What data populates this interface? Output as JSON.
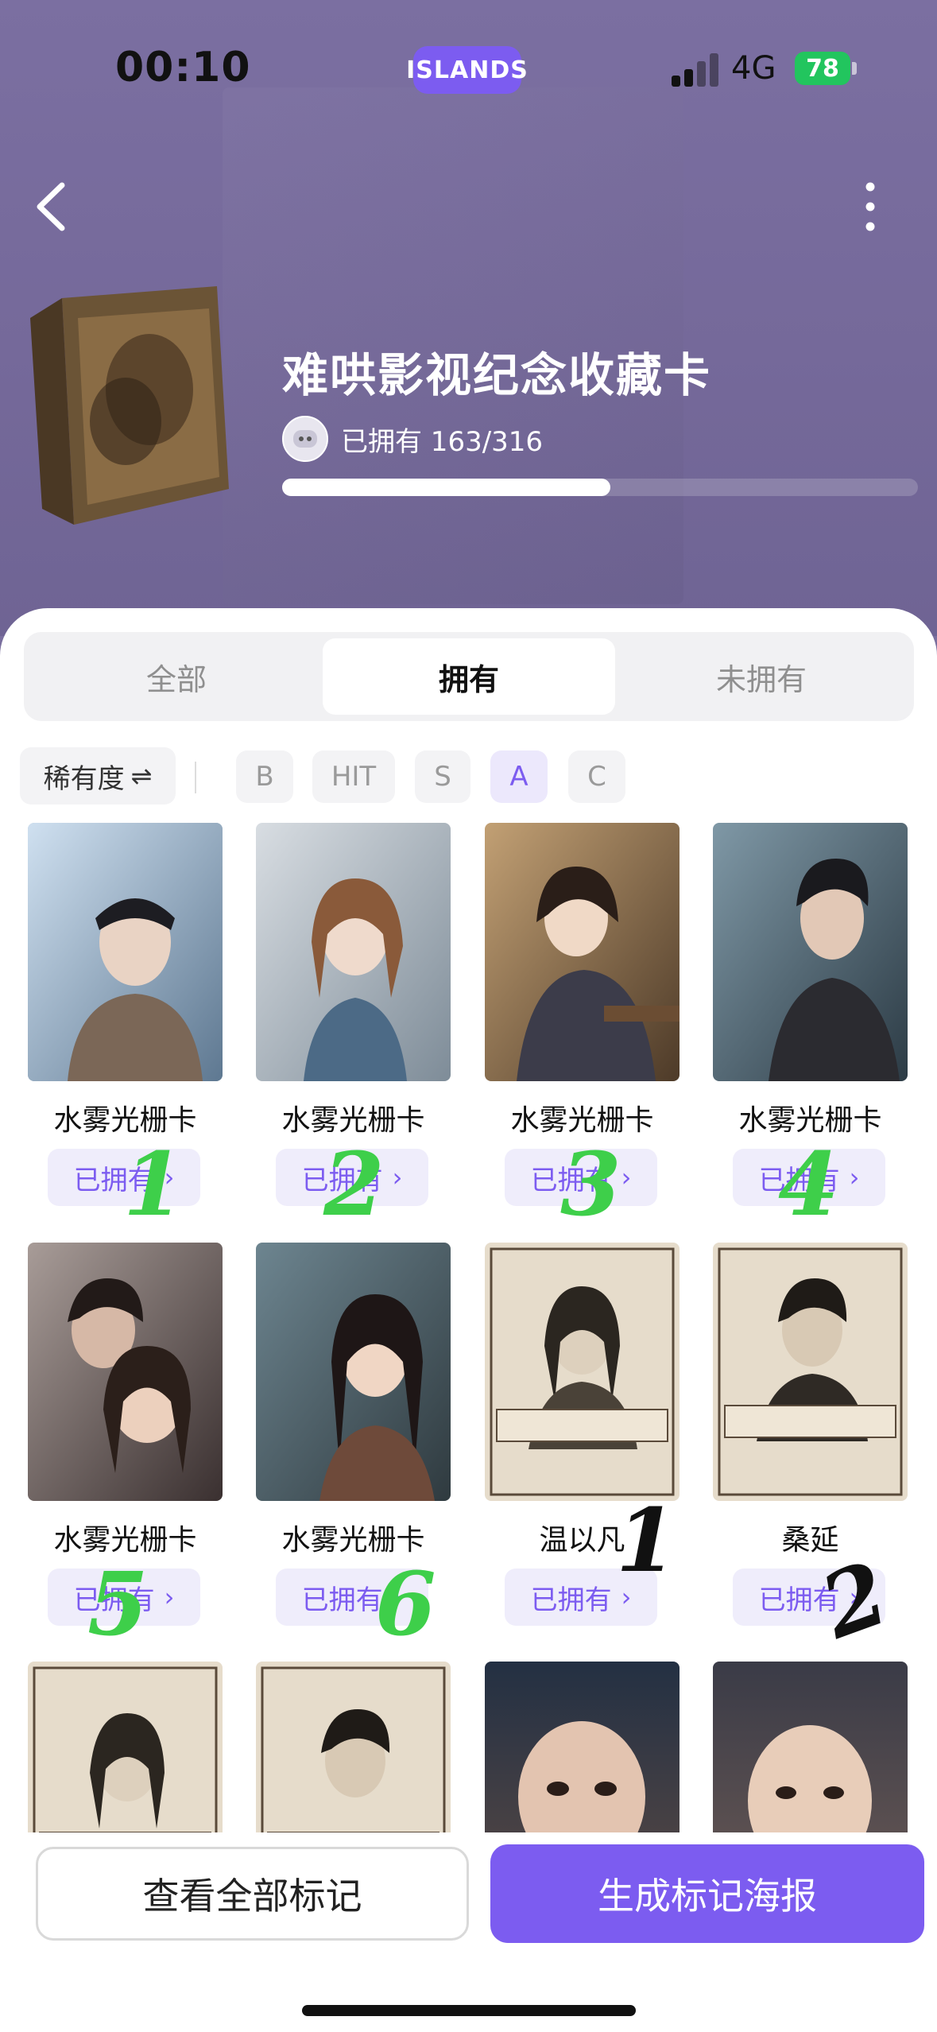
{
  "status_bar": {
    "time": "00:10",
    "islands": "ISLANDS",
    "network": "4G",
    "battery": "78"
  },
  "header": {
    "title": "难哄影视纪念收藏卡",
    "owned_label": "已拥有 163/316",
    "progress": 0.516
  },
  "tabs": [
    {
      "label": "全部",
      "active": false
    },
    {
      "label": "拥有",
      "active": true
    },
    {
      "label": "未拥有",
      "active": false
    }
  ],
  "filters": {
    "sort_label": "稀有度",
    "sort_icon": "⇌",
    "chips": [
      "B",
      "HIT",
      "S",
      "A",
      "C"
    ],
    "active_chip": "A"
  },
  "cards": [
    {
      "title": "水雾光栅卡",
      "owned_label": "已拥有",
      "chevron": "›",
      "mark": "1",
      "mark_color": "#3ecf4a"
    },
    {
      "title": "水雾光栅卡",
      "owned_label": "已拥有",
      "chevron": "›",
      "mark": "2",
      "mark_color": "#3ecf4a"
    },
    {
      "title": "水雾光栅卡",
      "owned_label": "已拥有",
      "chevron": "›",
      "mark": "3",
      "mark_color": "#3ecf4a"
    },
    {
      "title": "水雾光栅卡",
      "owned_label": "已拥有",
      "chevron": "›",
      "mark": "4",
      "mark_color": "#3ecf4a"
    },
    {
      "title": "水雾光栅卡",
      "owned_label": "已拥有",
      "chevron": "›",
      "mark": "5",
      "mark_color": "#3ecf4a"
    },
    {
      "title": "水雾光栅卡",
      "owned_label": "已拥有",
      "chevron": "›",
      "mark": "6",
      "mark_color": "#3ecf4a"
    },
    {
      "title": "温以凡",
      "owned_label": "已拥有",
      "chevron": "›",
      "mark": "1",
      "mark_color": "#111111"
    },
    {
      "title": "桑延",
      "owned_label": "已拥有",
      "chevron": "›",
      "mark": "2",
      "mark_color": "#111111"
    },
    {
      "title": "",
      "owned_label": "",
      "chevron": "",
      "mark": "",
      "mark_color": ""
    },
    {
      "title": "",
      "owned_label": "",
      "chevron": "",
      "mark": "",
      "mark_color": ""
    },
    {
      "title": "",
      "owned_label": "",
      "chevron": "",
      "mark": "",
      "mark_color": ""
    },
    {
      "title": "",
      "owned_label": "",
      "chevron": "",
      "mark": "",
      "mark_color": ""
    }
  ],
  "bottom": {
    "view_all_label": "查看全部标记",
    "generate_label": "生成标记海报"
  }
}
